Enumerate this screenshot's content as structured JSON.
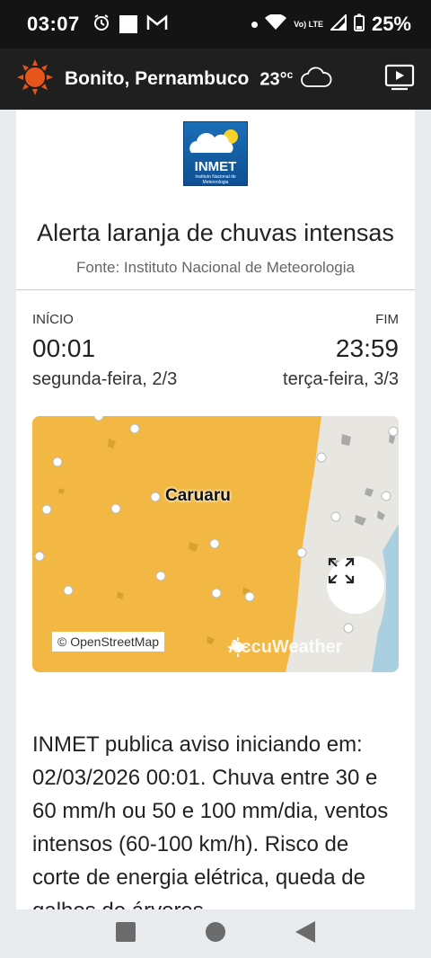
{
  "status_bar": {
    "time": "03:07",
    "network": "Vo) LTE",
    "battery": "25%",
    "icons": [
      "alarm-icon",
      "notification-square-icon",
      "gmail-icon",
      "dot-icon",
      "wifi-icon",
      "signal-icon",
      "battery-icon"
    ]
  },
  "app_bar": {
    "location": "Bonito, Pernambuco",
    "temperature": "23°",
    "temperature_unit": "c",
    "icons": [
      "sun-icon",
      "cloud-icon",
      "video-icon"
    ]
  },
  "alert": {
    "logo_text": "INMET",
    "logo_subtext": "Instituto Nacional de Meteorologia",
    "title": "Alerta laranja de chuvas intensas",
    "source": "Fonte: Instituto Nacional de Meteorologia",
    "start_label": "INÍCIO",
    "start_time": "00:01",
    "start_date": "segunda-feira, 2/3",
    "end_label": "FIM",
    "end_time": "23:59",
    "end_date": "terça-feira, 3/3"
  },
  "map": {
    "city_label": "Caruaru",
    "attribution": "© OpenStreetMap",
    "watermark": "AccuWeather",
    "alert_color": "#f3b843"
  },
  "description": "INMET publica aviso iniciando em: 02/03/2026 00:01. Chuva entre 30 e 60 mm/h ou 50 e 100 mm/dia, ventos intensos (60-100 km/h). Risco de corte de energia elétrica, queda de galhos de árvores",
  "nav": [
    "recents-button",
    "home-button",
    "back-button"
  ]
}
